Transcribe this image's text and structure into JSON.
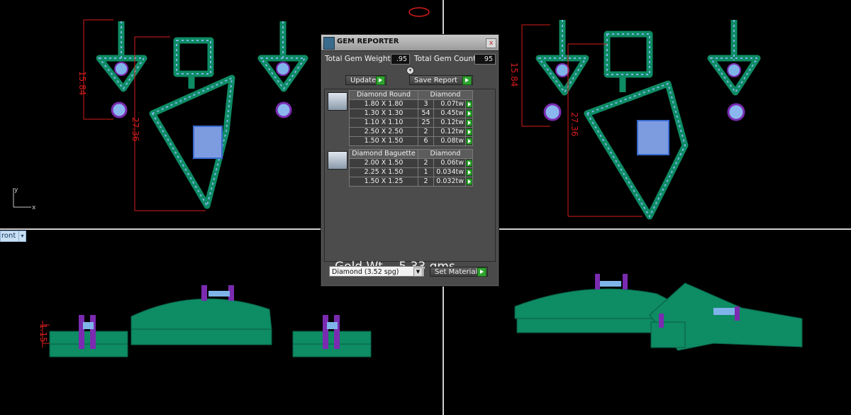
{
  "viewports": {
    "top_left": {
      "dimensions": {
        "height_left": "15.84",
        "height_right": "27.36"
      },
      "axis": {
        "y": "y",
        "x": "x"
      }
    },
    "top_right": {
      "dimensions": {
        "height_left": "15.84",
        "height_right": "27.36"
      }
    },
    "bottom_left": {
      "view_label": "ront",
      "dimension": "1.15"
    }
  },
  "gem_reporter": {
    "title": "GEM REPORTER",
    "close_glyph": "x",
    "total_gem_weight_label": "Total Gem Weight",
    "total_gem_weight_value": ".95",
    "total_gem_count_label": "Total Gem Count",
    "total_gem_count_value": "95",
    "update_label": "Update",
    "save_report_label": "Save Report",
    "groups": [
      {
        "name": "Diamond Round",
        "material": "Diamond",
        "rows": [
          {
            "size": "1.80 X 1.80",
            "count": "3",
            "weight": "0.07tw"
          },
          {
            "size": "1.30 X 1.30",
            "count": "54",
            "weight": "0.45tw"
          },
          {
            "size": "1.10 X 1.10",
            "count": "25",
            "weight": "0.12tw"
          },
          {
            "size": "2.50 X 2.50",
            "count": "2",
            "weight": "0.12tw"
          },
          {
            "size": "1.50 X 1.50",
            "count": "6",
            "weight": "0.08tw"
          }
        ]
      },
      {
        "name": "Diamond Baguette",
        "material": "Diamond",
        "rows": [
          {
            "size": "2.00 X 1.50",
            "count": "2",
            "weight": "0.06tw"
          },
          {
            "size": "2.25 X 1.50",
            "count": "1",
            "weight": "0.034tw"
          },
          {
            "size": "1.50 X 1.25",
            "count": "2",
            "weight": "0.032tw"
          }
        ]
      }
    ],
    "gold_weight": "Gold Wt. - 5.33 gms",
    "material_select": "Diamond    (3.52 spg)",
    "set_material_label": "Set Material"
  },
  "colors": {
    "metal": "#0e8c64",
    "gem": "#7fb4ea",
    "prong": "#7a2bb0",
    "dimension": "#d81c1c",
    "panel": "#4a4a4a"
  }
}
